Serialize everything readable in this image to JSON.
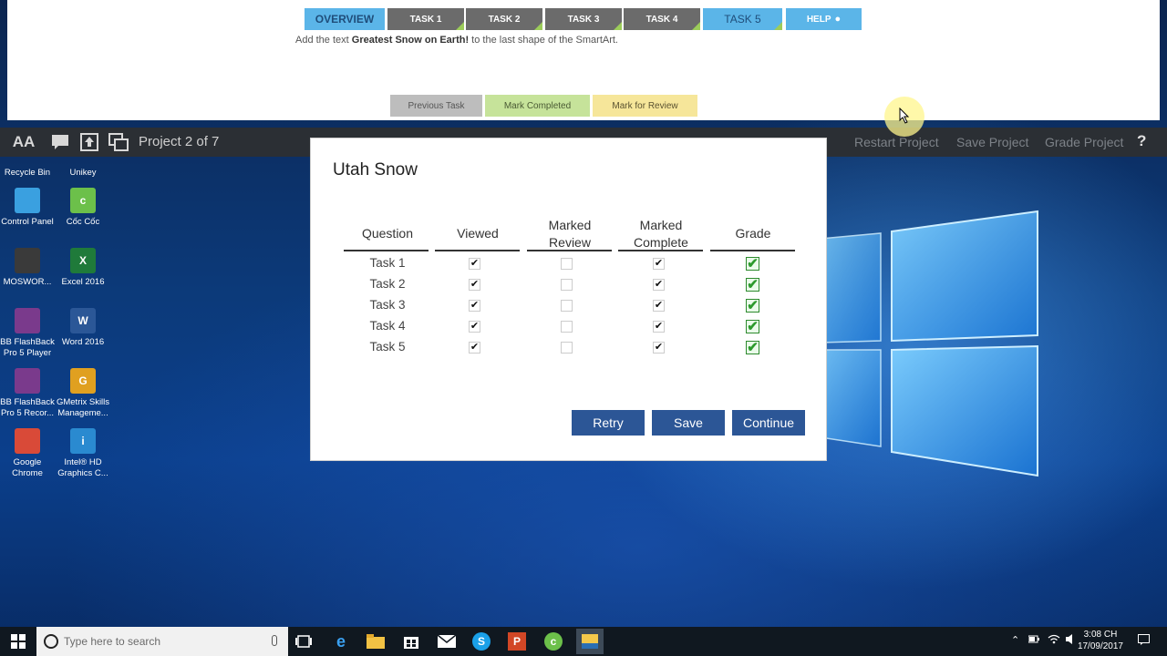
{
  "tabs": [
    {
      "label": "OVERVIEW"
    },
    {
      "label": "TASK 1"
    },
    {
      "label": "TASK 2"
    },
    {
      "label": "TASK 3"
    },
    {
      "label": "TASK 4"
    },
    {
      "label": "TASK 5"
    },
    {
      "label": "HELP"
    }
  ],
  "instruction": {
    "pre": "Add the text ",
    "bold": "Greatest Snow on Earth!",
    "post": " to the last shape of the SmartArt."
  },
  "panel_buttons": {
    "previous": "Previous Task",
    "completed": "Mark Completed",
    "review": "Mark for Review"
  },
  "toolbar": {
    "project": "Project 2 of 7",
    "restart": "Restart Project",
    "save": "Save Project",
    "grade": "Grade Project",
    "help": "?"
  },
  "desktop_icons": [
    {
      "label": "Recycle Bin",
      "icon": "recycle-bin-icon"
    },
    {
      "label": "Unikey",
      "icon": "unikey-icon"
    },
    {
      "label": "Control Panel",
      "icon": "control-panel-icon"
    },
    {
      "label": "Cốc Cốc",
      "icon": "coccoc-icon"
    },
    {
      "label": "MOSWOR...",
      "icon": "mos-word-icon"
    },
    {
      "label": "Excel 2016",
      "icon": "excel-icon"
    },
    {
      "label": "BB FlashBack Pro 5 Player",
      "icon": "flashback-player-icon"
    },
    {
      "label": "Word 2016",
      "icon": "word-icon"
    },
    {
      "label": "BB FlashBack Pro 5 Recor...",
      "icon": "flashback-recorder-icon"
    },
    {
      "label": "GMetrix Skills Manageme...",
      "icon": "gmetrix-icon"
    },
    {
      "label": "Google Chrome",
      "icon": "chrome-icon"
    },
    {
      "label": "Intel® HD Graphics C...",
      "icon": "intel-graphics-icon"
    }
  ],
  "modal": {
    "title": "Utah Snow",
    "headers": [
      "Question",
      "Viewed",
      "Marked Review",
      "Marked Complete",
      "Grade"
    ],
    "rows": [
      {
        "question": "Task 1",
        "viewed": true,
        "review": false,
        "complete": true,
        "grade": true
      },
      {
        "question": "Task 2",
        "viewed": true,
        "review": false,
        "complete": true,
        "grade": true
      },
      {
        "question": "Task 3",
        "viewed": true,
        "review": false,
        "complete": true,
        "grade": true
      },
      {
        "question": "Task 4",
        "viewed": true,
        "review": false,
        "complete": true,
        "grade": true
      },
      {
        "question": "Task 5",
        "viewed": true,
        "review": false,
        "complete": true,
        "grade": true
      }
    ],
    "buttons": {
      "retry": "Retry",
      "save": "Save",
      "continue": "Continue"
    }
  },
  "taskbar": {
    "search_placeholder": "Type here to search",
    "time": "3:08 CH",
    "date": "17/09/2017"
  },
  "colors": {
    "modal_button": "#2c5696",
    "tab_active": "#5bb5e8",
    "tab_dark": "#6b6b6b",
    "mark_completed": "#c6e39a",
    "mark_review": "#f6e69a"
  }
}
